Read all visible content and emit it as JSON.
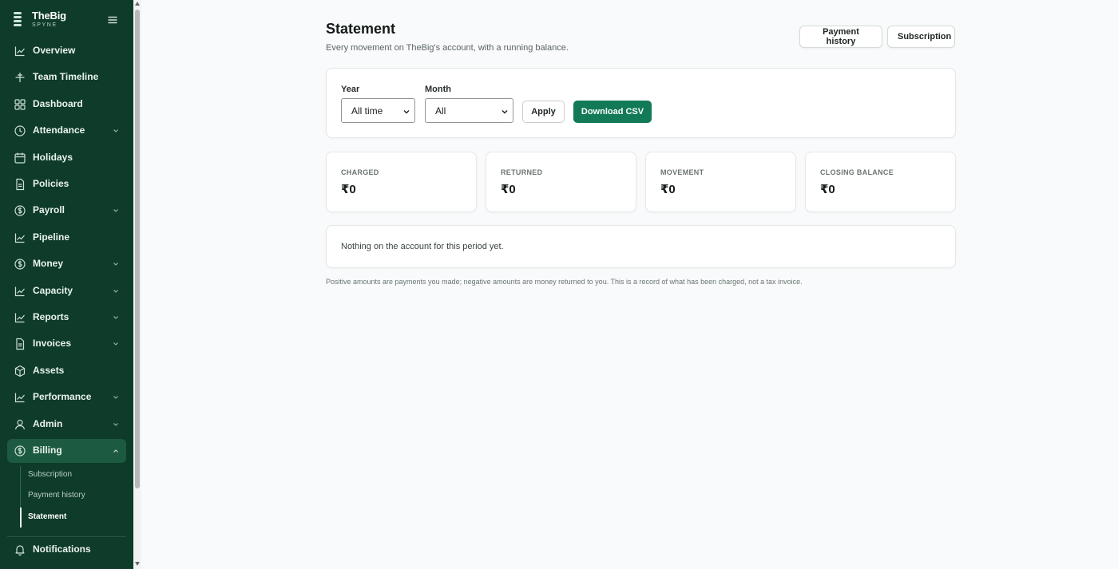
{
  "brand": {
    "name": "TheBig",
    "sub": "SPYNE"
  },
  "nav": [
    {
      "label": "Overview",
      "icon": "chart-line-icon"
    },
    {
      "label": "Team Timeline",
      "icon": "timeline-icon"
    },
    {
      "label": "Dashboard",
      "icon": "grid-icon"
    },
    {
      "label": "Attendance",
      "icon": "clock-icon",
      "chevron": true
    },
    {
      "label": "Holidays",
      "icon": "calendar-icon"
    },
    {
      "label": "Policies",
      "icon": "document-icon"
    },
    {
      "label": "Payroll",
      "icon": "currency-circle-icon",
      "chevron": true
    },
    {
      "label": "Pipeline",
      "icon": "chart-line-icon"
    },
    {
      "label": "Money",
      "icon": "currency-circle-icon",
      "chevron": true
    },
    {
      "label": "Capacity",
      "icon": "chart-line-icon",
      "chevron": true
    },
    {
      "label": "Reports",
      "icon": "chart-line-icon",
      "chevron": true
    },
    {
      "label": "Invoices",
      "icon": "document-icon",
      "chevron": true
    },
    {
      "label": "Assets",
      "icon": "box-icon"
    },
    {
      "label": "Performance",
      "icon": "chart-line-icon",
      "chevron": true
    },
    {
      "label": "Admin",
      "icon": "user-icon",
      "chevron": true
    },
    {
      "label": "Billing",
      "icon": "currency-circle-icon",
      "chevron": true,
      "expanded": true
    }
  ],
  "billing_sub": [
    "Subscription",
    "Payment history",
    "Statement"
  ],
  "billing_current": "Statement",
  "notifications": {
    "label": "Notifications",
    "icon": "bell-icon"
  },
  "header": {
    "title": "Statement",
    "subtitle": "Every movement on TheBig's account, with a running balance.",
    "payment_history": "Payment history",
    "subscription": "Subscription"
  },
  "filters": {
    "year_label": "Year",
    "year_value": "All time",
    "month_label": "Month",
    "month_value": "All",
    "apply": "Apply",
    "download": "Download CSV"
  },
  "stats": [
    {
      "label": "CHARGED",
      "value": "₹0"
    },
    {
      "label": "RETURNED",
      "value": "₹0"
    },
    {
      "label": "MOVEMENT",
      "value": "₹0"
    },
    {
      "label": "CLOSING BALANCE",
      "value": "₹0"
    }
  ],
  "empty_message": "Nothing on the account for this period yet.",
  "footnote": "Positive amounts are payments you made; negative amounts are money returned to you. This is a record of what has been charged, not a tax invoice.",
  "colors": {
    "sidebar": "#0e3b2a",
    "active": "#1c5a41",
    "accent": "#137a57"
  }
}
